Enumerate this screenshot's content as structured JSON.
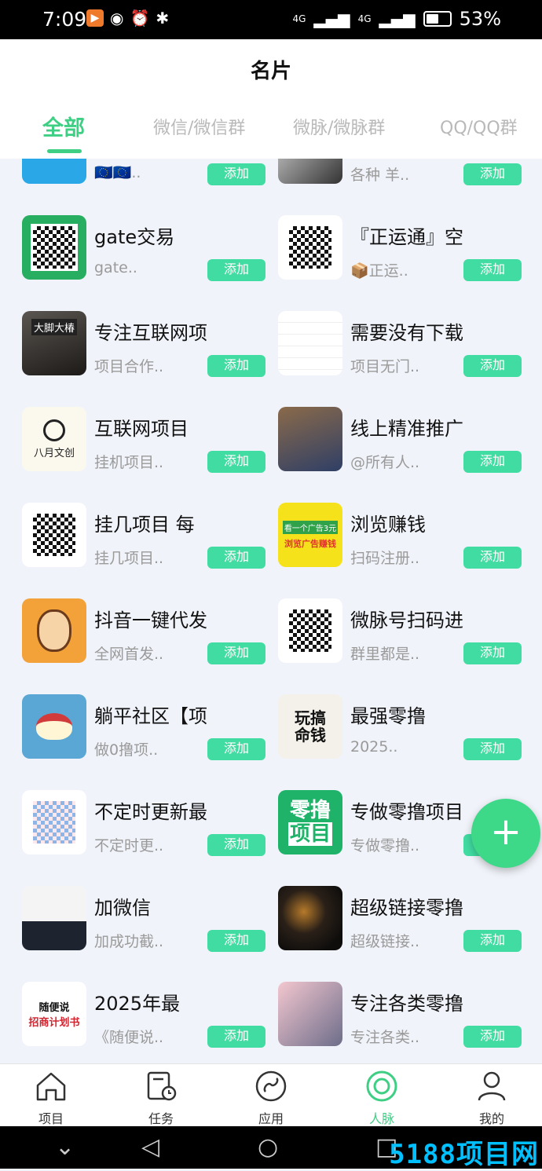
{
  "status": {
    "time": "7:09",
    "battery": "53%",
    "battery_level": 0.53,
    "net1": "4G",
    "net2": "4G"
  },
  "header": {
    "title": "名片"
  },
  "tabs": [
    {
      "label": "全部",
      "active": true
    },
    {
      "label": "微信/微信群",
      "active": false
    },
    {
      "label": "微脉/微脉群",
      "active": false
    },
    {
      "label": "QQ/QQ群",
      "active": false
    }
  ],
  "cards": [
    {
      "title": "",
      "sub": "🇪🇺🇪🇺..",
      "add": "添加"
    },
    {
      "title": "",
      "sub": "各种 羊..",
      "add": "添加"
    },
    {
      "title": "gate交易",
      "sub": "gate..",
      "add": "添加"
    },
    {
      "title": "『正运通』空",
      "sub": "📦正运..",
      "add": "添加"
    },
    {
      "title": "专注互联网项",
      "sub": "项目合作..",
      "add": "添加"
    },
    {
      "title": "需要没有下载",
      "sub": "项目无门..",
      "add": "添加"
    },
    {
      "title": "互联网项目",
      "sub": "挂机项目..",
      "add": "添加"
    },
    {
      "title": "线上精准推广",
      "sub": "@所有人..",
      "add": "添加"
    },
    {
      "title": "挂几项目 每",
      "sub": "挂几项目..",
      "add": "添加"
    },
    {
      "title": "浏览赚钱",
      "sub": "扫码注册..",
      "add": "添加"
    },
    {
      "title": "抖音一键代发",
      "sub": "全网首发..",
      "add": "添加"
    },
    {
      "title": "微脉号扫码进",
      "sub": "群里都是..",
      "add": "添加"
    },
    {
      "title": "躺平社区【项",
      "sub": "做0撸项..",
      "add": "添加"
    },
    {
      "title": "最强零撸",
      "sub": "2025..",
      "add": "添加"
    },
    {
      "title": "不定时更新最",
      "sub": "不定时更..",
      "add": "添加"
    },
    {
      "title": "专做零撸项目",
      "sub": "专做零撸..",
      "add": "添加"
    },
    {
      "title": "加微信",
      "sub": "加成功截..",
      "add": "添加"
    },
    {
      "title": "超级链接零撸",
      "sub": "超级链接..",
      "add": "添加"
    },
    {
      "title": "2025年最",
      "sub": "《随便说..",
      "add": "添加"
    },
    {
      "title": "专注各类零撸",
      "sub": "专注各类..",
      "add": "添加"
    }
  ],
  "thumb_text": {
    "bayue": "八月文创",
    "liulan_top": "看一个广告3元",
    "liulan_bottom": "浏览广告赚钱",
    "wangao": "玩搞\n命钱",
    "zero_top": "零撸",
    "zero_bottom": "项目",
    "suibian": "随便说",
    "zhaoshang": "招商计划书",
    "dajiao": "大脚大椿"
  },
  "nav": [
    {
      "label": "项目",
      "icon": "home-icon",
      "active": false
    },
    {
      "label": "任务",
      "icon": "task-icon",
      "active": false
    },
    {
      "label": "应用",
      "icon": "apps-icon",
      "active": false
    },
    {
      "label": "人脉",
      "icon": "contacts-icon",
      "active": true
    },
    {
      "label": "我的",
      "icon": "profile-icon",
      "active": false
    }
  ],
  "fab": {
    "label": "+"
  },
  "watermark": "5188项目网",
  "colors": {
    "accent": "#3ecf84",
    "add_button": "#41dca2",
    "background": "#f0f3f9"
  }
}
